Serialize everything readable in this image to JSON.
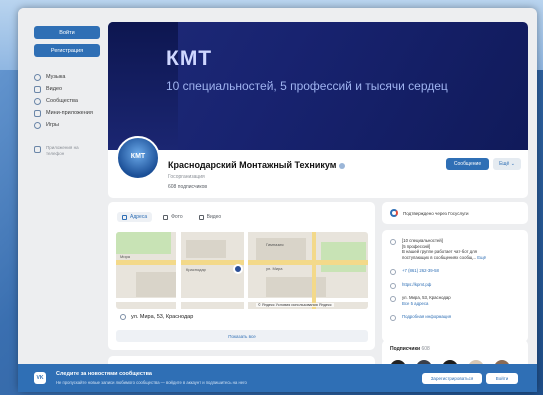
{
  "nav": {
    "login_label": "Войти",
    "register_label": "Регистрация",
    "items": [
      {
        "label": "Музыка",
        "icon": "music-icon"
      },
      {
        "label": "Видео",
        "icon": "video-icon"
      },
      {
        "label": "Сообщества",
        "icon": "community-icon"
      },
      {
        "label": "Мини-приложения",
        "icon": "apps-icon"
      },
      {
        "label": "Игры",
        "icon": "games-icon"
      }
    ],
    "apps_promo": "Приложения на телефон"
  },
  "cover": {
    "title": "КМТ",
    "subtitle": "10 специальностей, 5 профессий и тысячи сердец"
  },
  "profile": {
    "avatar_text": "КМТ",
    "name": "Краснодарский Монтажный Техникум",
    "type": "Госорганизация",
    "subscribers": "608 подписчиков",
    "message_button": "Сообщение",
    "more_button": "Ещё ⌄"
  },
  "main": {
    "tabs": [
      {
        "label": "Адреса",
        "active": true
      },
      {
        "label": "Фото",
        "active": false
      },
      {
        "label": "Видео",
        "active": false
      }
    ],
    "map_labels": [
      "Мира",
      "Краснодар",
      "ул. Мира",
      "Гимназия",
      "Яндекс"
    ],
    "map_footer": "© Яндекс Условия использования  Яндекс",
    "address": "ул. Мира, 53, Краснодар",
    "show_all": "Показать все"
  },
  "right": {
    "gosuslugi": "Подтверждено через Госуслуги",
    "info_desc_lines": [
      "[10 специальностей]",
      "[5 профессий]",
      "В нашей группе работает чат-бот для",
      "поступающих в сообщениях сообщ..."
    ],
    "info_more": "Ещё",
    "phone": "+7 (861) 262-39-58",
    "site": "https://kpmt.рф",
    "address_lines": [
      "ул. Мира, 53, Краснодар",
      "Все 5 адреса"
    ],
    "details": "Подробная информация",
    "subs_title": "Подписчики",
    "subs_count": "608"
  },
  "banner": {
    "logo": "VK",
    "title": "Следите за новостями сообщества",
    "subtitle": "Не пропускайте новые записи любимого сообщества — войдите в аккаунт и подпишитесь на него",
    "signup_button": "Зарегистрироваться",
    "signin_button": "Войти"
  },
  "colors": {
    "accent": "#2f6fb5",
    "cover": "#182370",
    "page_bg": "#edeef0"
  }
}
